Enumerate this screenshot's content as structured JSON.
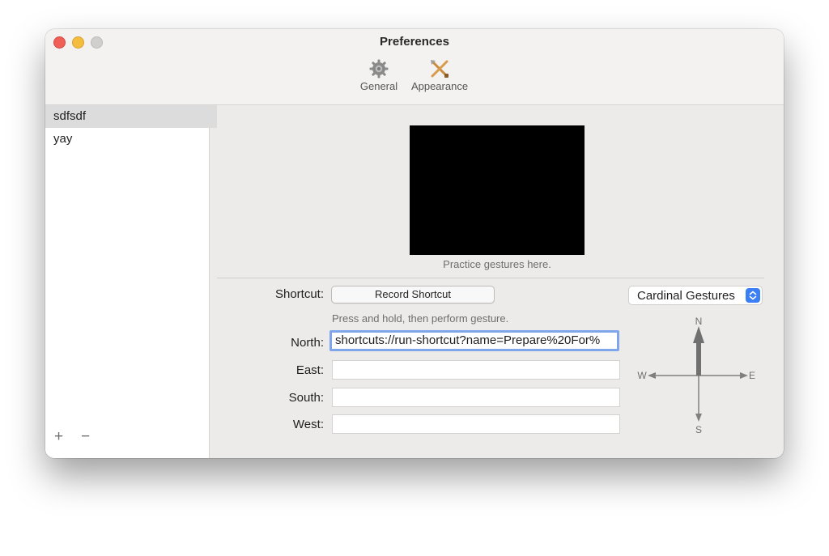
{
  "window": {
    "title": "Preferences"
  },
  "toolbar": {
    "items": [
      {
        "label": "General",
        "icon": "gear-icon"
      },
      {
        "label": "Appearance",
        "icon": "crossed-tools-icon"
      }
    ]
  },
  "sidebar": {
    "items": [
      {
        "label": "sdfsdf",
        "selected": true
      },
      {
        "label": "yay",
        "selected": false
      }
    ],
    "add_label": "+",
    "remove_label": "−"
  },
  "preview": {
    "caption": "Practice gestures here."
  },
  "form": {
    "shortcut_label": "Shortcut:",
    "record_button": "Record Shortcut",
    "hint": "Press and hold, then perform gesture.",
    "north_label": "North:",
    "north_value": "shortcuts://run-shortcut?name=Prepare%20For%",
    "east_label": "East:",
    "east_value": "",
    "south_label": "South:",
    "south_value": "",
    "west_label": "West:",
    "west_value": ""
  },
  "gesture_mode": {
    "selected": "Cardinal Gestures"
  },
  "compass": {
    "n": "N",
    "e": "E",
    "s": "S",
    "w": "W"
  },
  "colors": {
    "accent": "#3b7ff5",
    "focus_ring": "#7fa6ea"
  }
}
